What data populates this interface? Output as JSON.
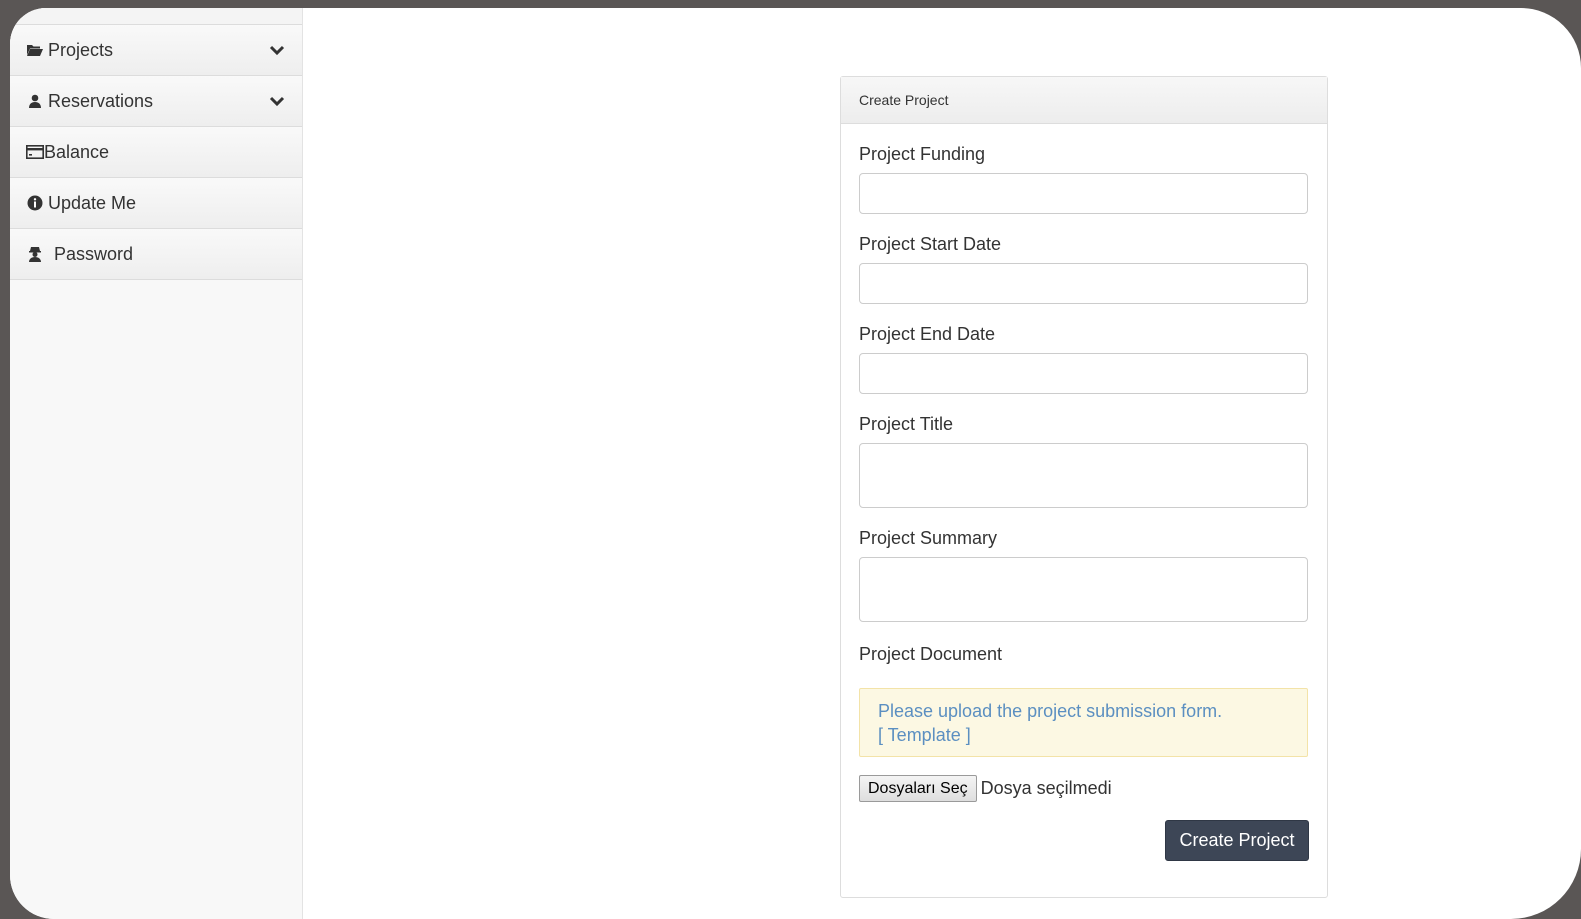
{
  "sidebar": {
    "items": [
      {
        "label": "Projects",
        "icon": "folder-open-icon",
        "has_chevron": true
      },
      {
        "label": "Reservations",
        "icon": "user-icon",
        "has_chevron": true
      },
      {
        "label": "Balance",
        "icon": "credit-card-icon",
        "has_chevron": false
      },
      {
        "label": "Update Me",
        "icon": "info-circle-icon",
        "has_chevron": false
      },
      {
        "label": "Password",
        "icon": "user-secret-icon",
        "has_chevron": false
      }
    ]
  },
  "form": {
    "heading": "Create Project",
    "fields": [
      {
        "label": "Project Funding",
        "value": ""
      },
      {
        "label": "Project Start Date",
        "value": ""
      },
      {
        "label": "Project End Date",
        "value": ""
      },
      {
        "label": "Project Title",
        "value": ""
      },
      {
        "label": "Project Summary",
        "value": ""
      }
    ],
    "document_label": "Project Document",
    "notice_text": "Please upload the project submission form.",
    "template_link": "[ Template ]",
    "file_button": "Dosyaları Seç",
    "file_status": "Dosya seçilmedi",
    "submit_label": "Create Project"
  },
  "colors": {
    "accent_button": "#3d4656",
    "notice_bg": "#fcf8e3",
    "link": "#5b8fc1"
  }
}
